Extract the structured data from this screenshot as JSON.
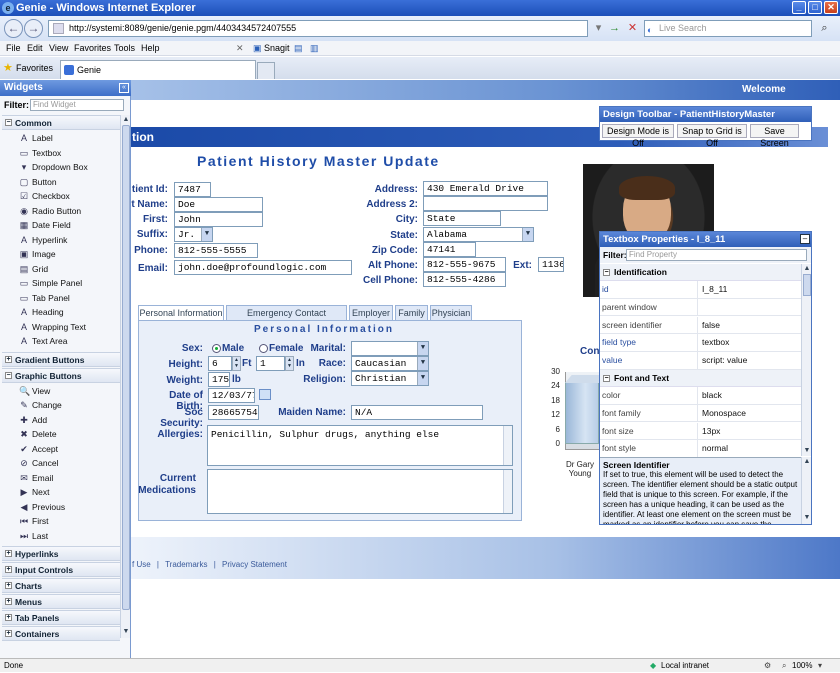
{
  "window": {
    "title": "Genie - Windows Internet Explorer"
  },
  "browser": {
    "url": "http://systemi:8089/genie/genie.pgm/4403434572407555",
    "search_placeholder": "Live Search",
    "menu": [
      "File",
      "Edit",
      "View",
      "Favorites",
      "Tools",
      "Help"
    ],
    "snagit": "Snagit",
    "favorites": "Favorites",
    "tab": "Genie"
  },
  "page": {
    "welcome": "Welcome",
    "header_fragment": "tion",
    "title": "Patient History Master Update",
    "fields_left": [
      {
        "label": "tient Id:",
        "value": "7487"
      },
      {
        "label": "t Name:",
        "value": "Doe"
      },
      {
        "label": "First:",
        "value": "John"
      },
      {
        "label": "Suffix:",
        "value": "Jr."
      },
      {
        "label": "Phone:",
        "value": "812-555-5555"
      },
      {
        "label": "Email:",
        "value": "john.doe@profoundlogic.com"
      }
    ],
    "fields_right": [
      {
        "label": "Address:",
        "value": "430 Emerald Drive"
      },
      {
        "label": "Address 2:",
        "value": ""
      },
      {
        "label": "City:",
        "value": "State"
      },
      {
        "label": "State:",
        "value": "Alabama"
      },
      {
        "label": "Zip Code:",
        "value": "47141"
      },
      {
        "label": "Alt Phone:",
        "value": "812-555-9675"
      },
      {
        "label": "Cell Phone:",
        "value": "812-555-4286"
      }
    ],
    "ext_label": "Ext:",
    "ext_value": "1136",
    "tabs": [
      "Personal Information",
      "Emergency Contact Information",
      "Employer",
      "Family",
      "Physician"
    ],
    "personal": {
      "header": "Personal Information",
      "sex_label": "Sex:",
      "male": "Male",
      "female": "Female",
      "marital_label": "Marital:",
      "marital_value": "",
      "height_label": "Height:",
      "height_ft": "6",
      "ft": "Ft",
      "height_in": "1",
      "in": "In",
      "race_label": "Race:",
      "race_value": "Caucasian",
      "weight_label": "Weight:",
      "weight_value": "175",
      "lb": "lb",
      "religion_label": "Religion:",
      "religion_value": "Christian",
      "dob_label": "Date of Birth:",
      "dob_value": "12/03/77",
      "ssn_label": "Soc Security:",
      "ssn_value": "286657540",
      "maiden_label": "Maiden Name:",
      "maiden_value": "N/A",
      "allergies_label": "Allergies:",
      "allergies_value": "Penicillin, Sulphur drugs, anything else",
      "meds_label_1": "Current",
      "meds_label_2": "Medications",
      "meds_value": ""
    },
    "footer": [
      "f Use",
      "|",
      "Trademarks",
      "|",
      "Privacy Statement"
    ]
  },
  "chart_data": {
    "type": "bar",
    "title": "Cont",
    "categories": [
      "Dr Gary Young"
    ],
    "values": [
      26
    ],
    "ylim": [
      0,
      30
    ],
    "yticks": [
      "30",
      "24",
      "18",
      "12",
      "6",
      "0"
    ]
  },
  "widgets": {
    "title": "Widgets",
    "filter_label": "Filter:",
    "filter_placeholder": "Find Widget",
    "sections": [
      {
        "name": "Common",
        "expanded": true,
        "items": [
          {
            "label": "Label",
            "icon": "A"
          },
          {
            "label": "Textbox",
            "icon": "▭"
          },
          {
            "label": "Dropdown Box",
            "icon": "▾"
          },
          {
            "label": "Button",
            "icon": "▢"
          },
          {
            "label": "Checkbox",
            "icon": "☑"
          },
          {
            "label": "Radio Button",
            "icon": "◉"
          },
          {
            "label": "Date Field",
            "icon": "▦"
          },
          {
            "label": "Hyperlink",
            "icon": "A"
          },
          {
            "label": "Image",
            "icon": "▣"
          },
          {
            "label": "Grid",
            "icon": "▤"
          },
          {
            "label": "Simple Panel",
            "icon": "▭"
          },
          {
            "label": "Tab Panel",
            "icon": "▭"
          },
          {
            "label": "Heading",
            "icon": "A"
          },
          {
            "label": "Wrapping Text",
            "icon": "A"
          },
          {
            "label": "Text Area",
            "icon": "A"
          }
        ]
      },
      {
        "name": "Gradient Buttons",
        "expanded": false,
        "items": []
      },
      {
        "name": "Graphic Buttons",
        "expanded": true,
        "items": [
          {
            "label": "View",
            "icon": "🔍"
          },
          {
            "label": "Change",
            "icon": "✎"
          },
          {
            "label": "Add",
            "icon": "✚"
          },
          {
            "label": "Delete",
            "icon": "✖"
          },
          {
            "label": "Accept",
            "icon": "✔"
          },
          {
            "label": "Cancel",
            "icon": "⊘"
          },
          {
            "label": "Email",
            "icon": "✉"
          },
          {
            "label": "Next",
            "icon": "▶"
          },
          {
            "label": "Previous",
            "icon": "◀"
          },
          {
            "label": "First",
            "icon": "⏮"
          },
          {
            "label": "Last",
            "icon": "⏭"
          }
        ]
      },
      {
        "name": "Hyperlinks",
        "expanded": false,
        "items": []
      },
      {
        "name": "Input Controls",
        "expanded": false,
        "items": []
      },
      {
        "name": "Charts",
        "expanded": false,
        "items": []
      },
      {
        "name": "Menus",
        "expanded": false,
        "items": []
      },
      {
        "name": "Tab Panels",
        "expanded": false,
        "items": []
      },
      {
        "name": "Containers",
        "expanded": false,
        "items": []
      }
    ]
  },
  "design_toolbar": {
    "title": "Design Toolbar - PatientHistoryMaster",
    "buttons": [
      "Design Mode is Off",
      "Snap to Grid is Off",
      "Save Screen"
    ]
  },
  "properties": {
    "title": "Textbox Properties - I_8_11",
    "filter_label": "Filter:",
    "filter_placeholder": "Find Property",
    "categories": [
      {
        "name": "Identification",
        "rows": [
          {
            "key": "id",
            "value": "I_8_11",
            "highlight": true
          },
          {
            "key": "parent window",
            "value": "",
            "highlight": false
          },
          {
            "key": "screen identifier",
            "value": "false",
            "highlight": false
          },
          {
            "key": "field type",
            "value": "textbox",
            "highlight": true
          },
          {
            "key": "value",
            "value": "script: value",
            "highlight": true
          }
        ]
      },
      {
        "name": "Font and Text",
        "rows": [
          {
            "key": "color",
            "value": "black",
            "highlight": false
          },
          {
            "key": "font family",
            "value": "Monospace",
            "highlight": false
          },
          {
            "key": "font size",
            "value": "13px",
            "highlight": false
          },
          {
            "key": "font style",
            "value": "normal",
            "highlight": false
          }
        ]
      }
    ],
    "desc_title": "Screen Identifier",
    "desc_text": "If set to true, this element will be used to detect the screen. The identifier element should be a static output field that is unique to this screen. For example, if the screen has a unique heading, it can be used as the identifier. At least one element on the screen must be marked as an identifier before you can save the"
  },
  "status": {
    "left": "Done",
    "zone": "Local intranet",
    "zoom": "100%"
  }
}
